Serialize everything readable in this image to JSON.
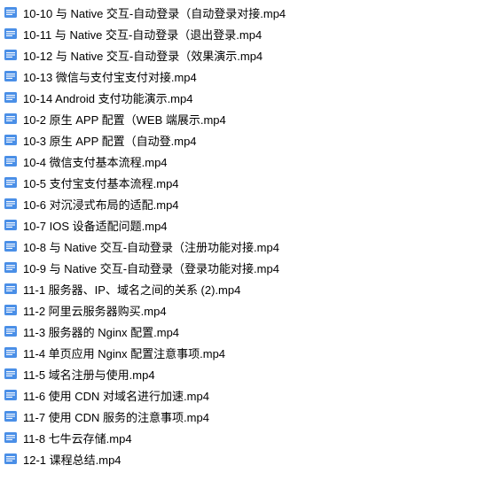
{
  "files": [
    {
      "name": "10-10 与 Native 交互-自动登录（自动登录对接.mp4"
    },
    {
      "name": "10-11 与 Native 交互-自动登录（退出登录.mp4"
    },
    {
      "name": "10-12 与 Native 交互-自动登录（效果演示.mp4"
    },
    {
      "name": "10-13 微信与支付宝支付对接.mp4"
    },
    {
      "name": "10-14 Android 支付功能演示.mp4"
    },
    {
      "name": "10-2 原生 APP 配置（WEB 端展示.mp4"
    },
    {
      "name": "10-3 原生 APP 配置（自动登.mp4"
    },
    {
      "name": "10-4 微信支付基本流程.mp4"
    },
    {
      "name": "10-5 支付宝支付基本流程.mp4"
    },
    {
      "name": "10-6 对沉浸式布局的适配.mp4"
    },
    {
      "name": "10-7 IOS 设备适配问题.mp4"
    },
    {
      "name": "10-8 与 Native 交互-自动登录（注册功能对接.mp4"
    },
    {
      "name": "10-9 与 Native 交互-自动登录（登录功能对接.mp4"
    },
    {
      "name": "11-1 服务器、IP、域名之间的关系 (2).mp4"
    },
    {
      "name": "11-2 阿里云服务器购买.mp4"
    },
    {
      "name": "11-3 服务器的 Nginx 配置.mp4"
    },
    {
      "name": "11-4 单页应用 Nginx 配置注意事项.mp4"
    },
    {
      "name": "11-5 域名注册与使用.mp4"
    },
    {
      "name": "11-6 使用 CDN 对域名进行加速.mp4"
    },
    {
      "name": "11-7 使用 CDN 服务的注意事项.mp4"
    },
    {
      "name": "11-8 七牛云存储.mp4"
    },
    {
      "name": "12-1 课程总结.mp4"
    }
  ],
  "icon_type": "video-file-icon",
  "icon_color": "#4a8fe7"
}
